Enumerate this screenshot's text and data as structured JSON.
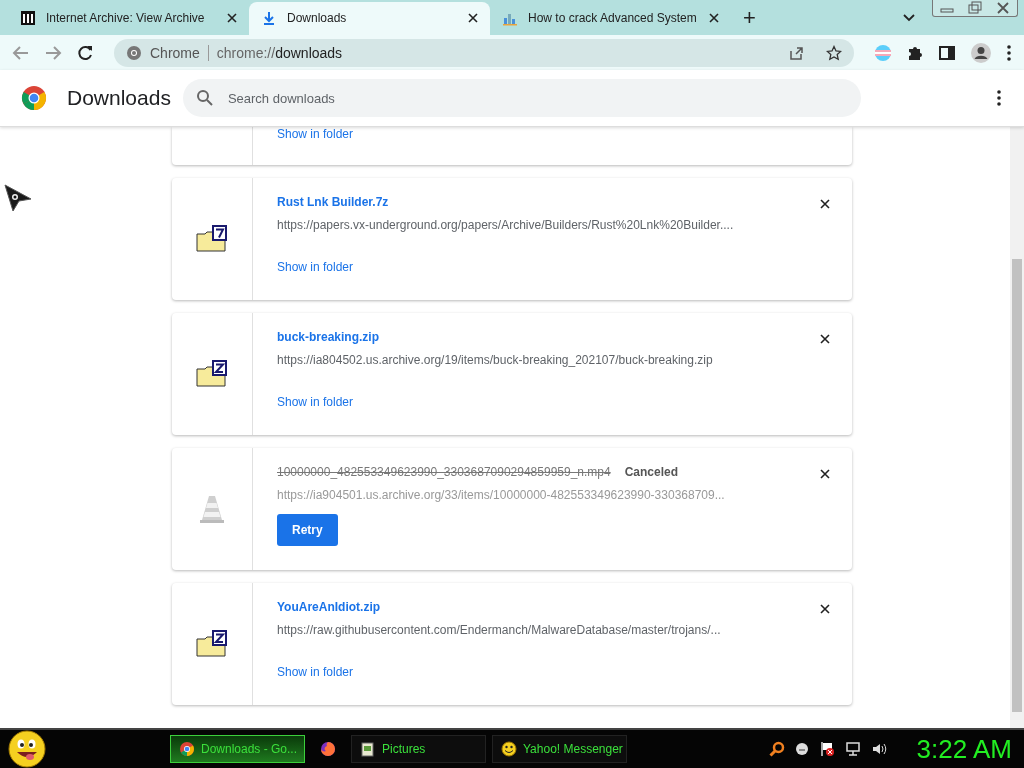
{
  "tabs": [
    {
      "title": "Internet Archive: View Archive",
      "selected": false
    },
    {
      "title": "Downloads",
      "selected": true
    },
    {
      "title": "How to crack Advanced System",
      "selected": false
    }
  ],
  "new_tab": "+",
  "address_bar": {
    "site": "Chrome",
    "url_prefix": "chrome://",
    "url_path": "downloads"
  },
  "header": {
    "title": "Downloads",
    "search_placeholder": "Search downloads"
  },
  "downloads": [
    {
      "kind": "cut",
      "action": "Show in folder"
    },
    {
      "kind": "archive-7",
      "name": "Rust Lnk Builder.7z",
      "url": "https://papers.vx-underground.org/papers/Archive/Builders/Rust%20Lnk%20Builder....",
      "action": "Show in folder"
    },
    {
      "kind": "archive-z",
      "name": "buck-breaking.zip",
      "url": "https://ia804502.us.archive.org/19/items/buck-breaking_202107/buck-breaking.zip",
      "action": "Show in folder"
    },
    {
      "kind": "canceled",
      "name": "10000000_482553349623990_3303687090294859959_n.mp4",
      "status": "Canceled",
      "url": "https://ia904501.us.archive.org/33/items/10000000-482553349623990-330368709...",
      "action": "Retry"
    },
    {
      "kind": "archive-z",
      "name": "YouAreAnIdiot.zip",
      "url": "https://raw.githubusercontent.com/Endermanch/MalwareDatabase/master/trojans/...",
      "action": "Show in folder"
    }
  ],
  "taskbar": {
    "items": [
      {
        "label": "Downloads - Go...",
        "selected": true
      },
      {
        "selected": false
      },
      {
        "label": "Pictures",
        "selected": false
      },
      {
        "label": "Yahoo! Messenger",
        "selected": false
      }
    ],
    "clock": "3:22 AM"
  }
}
